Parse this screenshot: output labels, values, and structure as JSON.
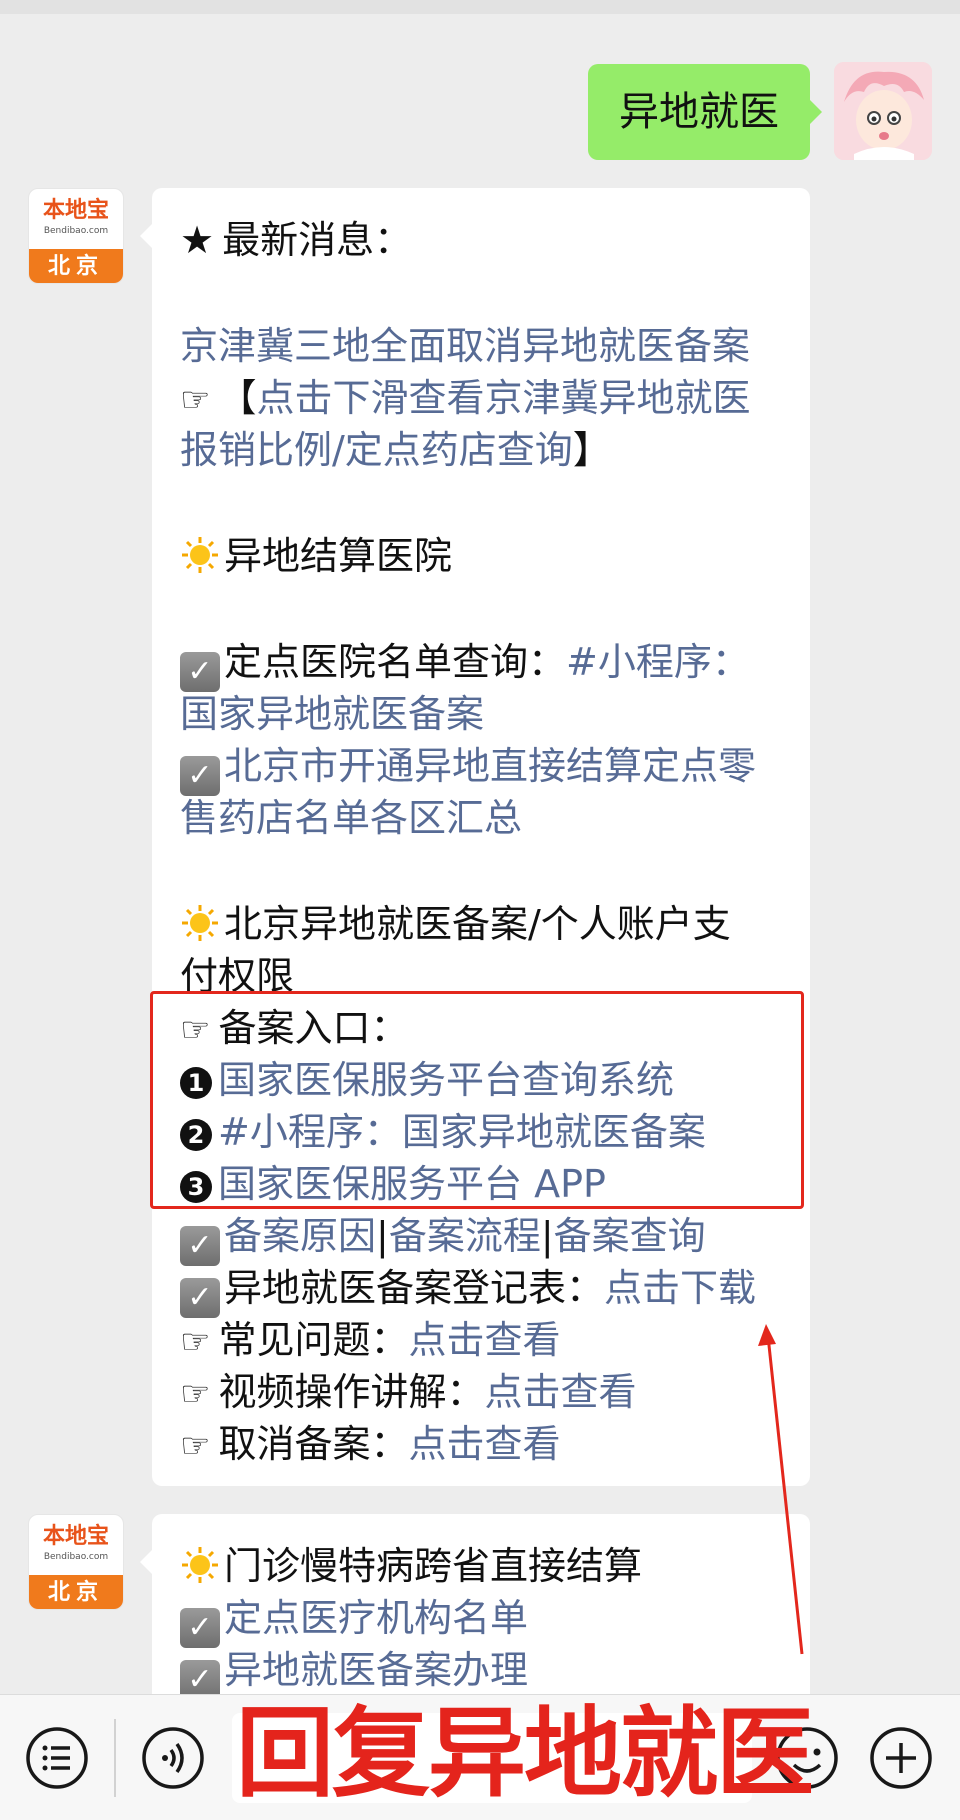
{
  "outgoing": {
    "text": "异地就医"
  },
  "bendibao": {
    "logo_text": "本地宝",
    "domain": "Bendibao.com",
    "city": "北京"
  },
  "bubble1": {
    "latest_news": "最新消息：",
    "headline_link": "京津冀三地全面取消异地就医备案",
    "bracket_open": "【",
    "reimburse_link_1": "点击下滑查看京津冀异地就医",
    "reimburse_link_2": "报销比例/定点药店查询",
    "bracket_close": "】",
    "section1_title": "异地结算医院",
    "hospital_query_label": "定点医院名单查询：",
    "hospital_query_link_1": "#小程序：",
    "hospital_query_link_2": "国家异地就医备案",
    "pharmacy_link_1": "北京市开通异地直接结算定点零",
    "pharmacy_link_2": "售药店名单各区汇总",
    "section2_title_1": "北京异地就医备案/个人账户支",
    "section2_title_2": "付权限",
    "entry_label": "备案入口：",
    "entry_1": "国家医保服务平台查询系统",
    "entry_2": "#小程序：国家异地就医备案",
    "entry_3": "国家医保服务平台 APP",
    "reason_link": "备案原因",
    "sep": "|",
    "process_link": "备案流程",
    "query_link": "备案查询",
    "form_label": "异地就医备案登记表：",
    "form_link": "点击下载",
    "faq_label": "常见问题：",
    "faq_link": "点击查看",
    "video_label": "视频操作讲解：",
    "video_link": "点击查看",
    "cancel_label": "取消备案：",
    "cancel_link": "点击查看"
  },
  "bubble2": {
    "section_title": "门诊慢特病跨省直接结算",
    "institutions_link": "定点医疗机构名单",
    "filing_link": "异地就医备案办理"
  },
  "overlay": {
    "text": "回复异地就医"
  },
  "colors": {
    "link": "#576b95",
    "bubble_out": "#95ec69",
    "highlight_red": "#e3271c"
  }
}
